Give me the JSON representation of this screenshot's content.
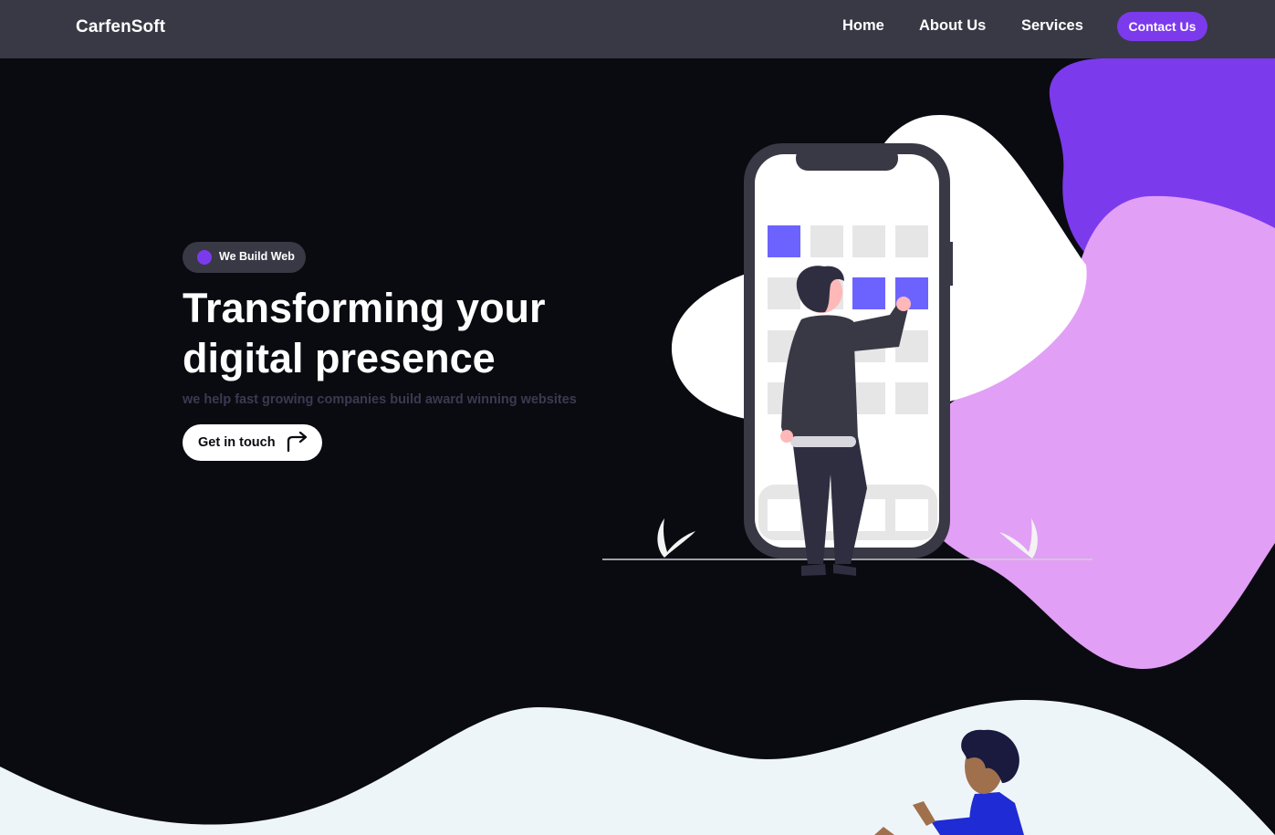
{
  "brand": {
    "name": "CarfenSoft"
  },
  "nav": {
    "items": [
      {
        "label": "Home"
      },
      {
        "label": "About Us"
      },
      {
        "label": "Services"
      }
    ],
    "contact_label": "Contact Us"
  },
  "hero": {
    "badge": "We Build Web",
    "title_line1": "Transforming your",
    "title_line2": "digital presence",
    "subtitle": "we help fast growing companies build award winning websites",
    "cta_label": "Get in touch",
    "cta_icon": "arrow-turn-right-icon"
  },
  "colors": {
    "background": "#0a0b10",
    "navbar": "#393845",
    "accent": "#7c3aed",
    "blob_pink": "#e29ff6",
    "phone_tile_active": "#6c63ff",
    "wave": "#eef5f8"
  }
}
